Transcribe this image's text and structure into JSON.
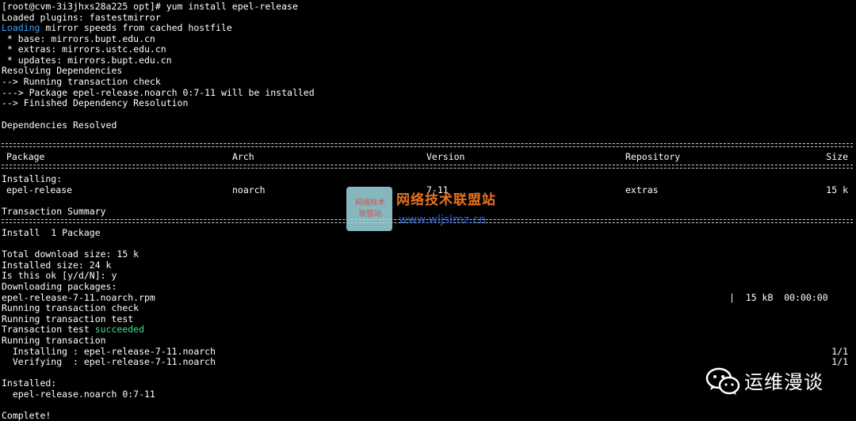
{
  "terminal": {
    "lines": [
      {
        "text": "[root@cvm-3i3jhxs28a225 opt]# yum install epel-release"
      },
      {
        "text": "Loaded plugins: fastestmirror"
      },
      {
        "prefix": "Loading",
        "text": " mirror speeds from cached hostfile"
      },
      {
        "text": " * base: mirrors.bupt.edu.cn"
      },
      {
        "text": " * extras: mirrors.ustc.edu.cn"
      },
      {
        "text": " * updates: mirrors.bupt.edu.cn"
      },
      {
        "text": "Resolving Dependencies"
      },
      {
        "text": "--> Running transaction check"
      },
      {
        "text": "---> Package epel-release.noarch 0:7-11 will be installed"
      },
      {
        "text": "--> Finished Dependency Resolution"
      },
      {
        "text": ""
      },
      {
        "text": "Dependencies Resolved"
      }
    ],
    "table": {
      "headers": [
        "Package",
        "Arch",
        "Version",
        "Repository",
        "Size"
      ],
      "section": "Installing:",
      "row": [
        "epel-release",
        "noarch",
        "7-11",
        "extras",
        "15 k"
      ]
    },
    "summary_title": "Transaction Summary",
    "install_line": "Install  1 Package",
    "lines2": [
      {
        "text": "Total download size: 15 k"
      },
      {
        "text": "Installed size: 24 k"
      },
      {
        "text": "Is this ok [y/d/N]: y"
      },
      {
        "text": "Downloading packages:"
      },
      {
        "text": "epel-release-7-11.noarch.rpm"
      },
      {
        "text": "Running transaction check"
      },
      {
        "text": "Running transaction test"
      },
      {
        "text": "Transaction test ",
        "suffix": "succeeded"
      },
      {
        "text": "Running transaction"
      },
      {
        "text": "  Installing : epel-release-7-11.noarch"
      },
      {
        "text": "  Verifying  : epel-release-7-11.noarch"
      },
      {
        "text": ""
      },
      {
        "text": "Installed:"
      },
      {
        "text": "  epel-release.noarch 0:7-11"
      },
      {
        "text": ""
      },
      {
        "text": "Complete!"
      }
    ],
    "download_stats": "|  15 kB  00:00:00",
    "installing_progress": "1/1",
    "verifying_progress": "1/1"
  },
  "watermark": {
    "logo_text_line1": "网络技术",
    "logo_text_line2": "联盟站",
    "title": "网络技术联盟站",
    "url": "www.wljslmz.cn"
  },
  "brand": {
    "label": "运维漫谈",
    "icon": "wechat-icon"
  },
  "colors": {
    "background": "#000000",
    "text": "#ffffff",
    "loading": "#3aa6ff",
    "succeeded": "#3be08a",
    "watermark_title": "#e8731e",
    "watermark_url": "#2b5fd6"
  }
}
